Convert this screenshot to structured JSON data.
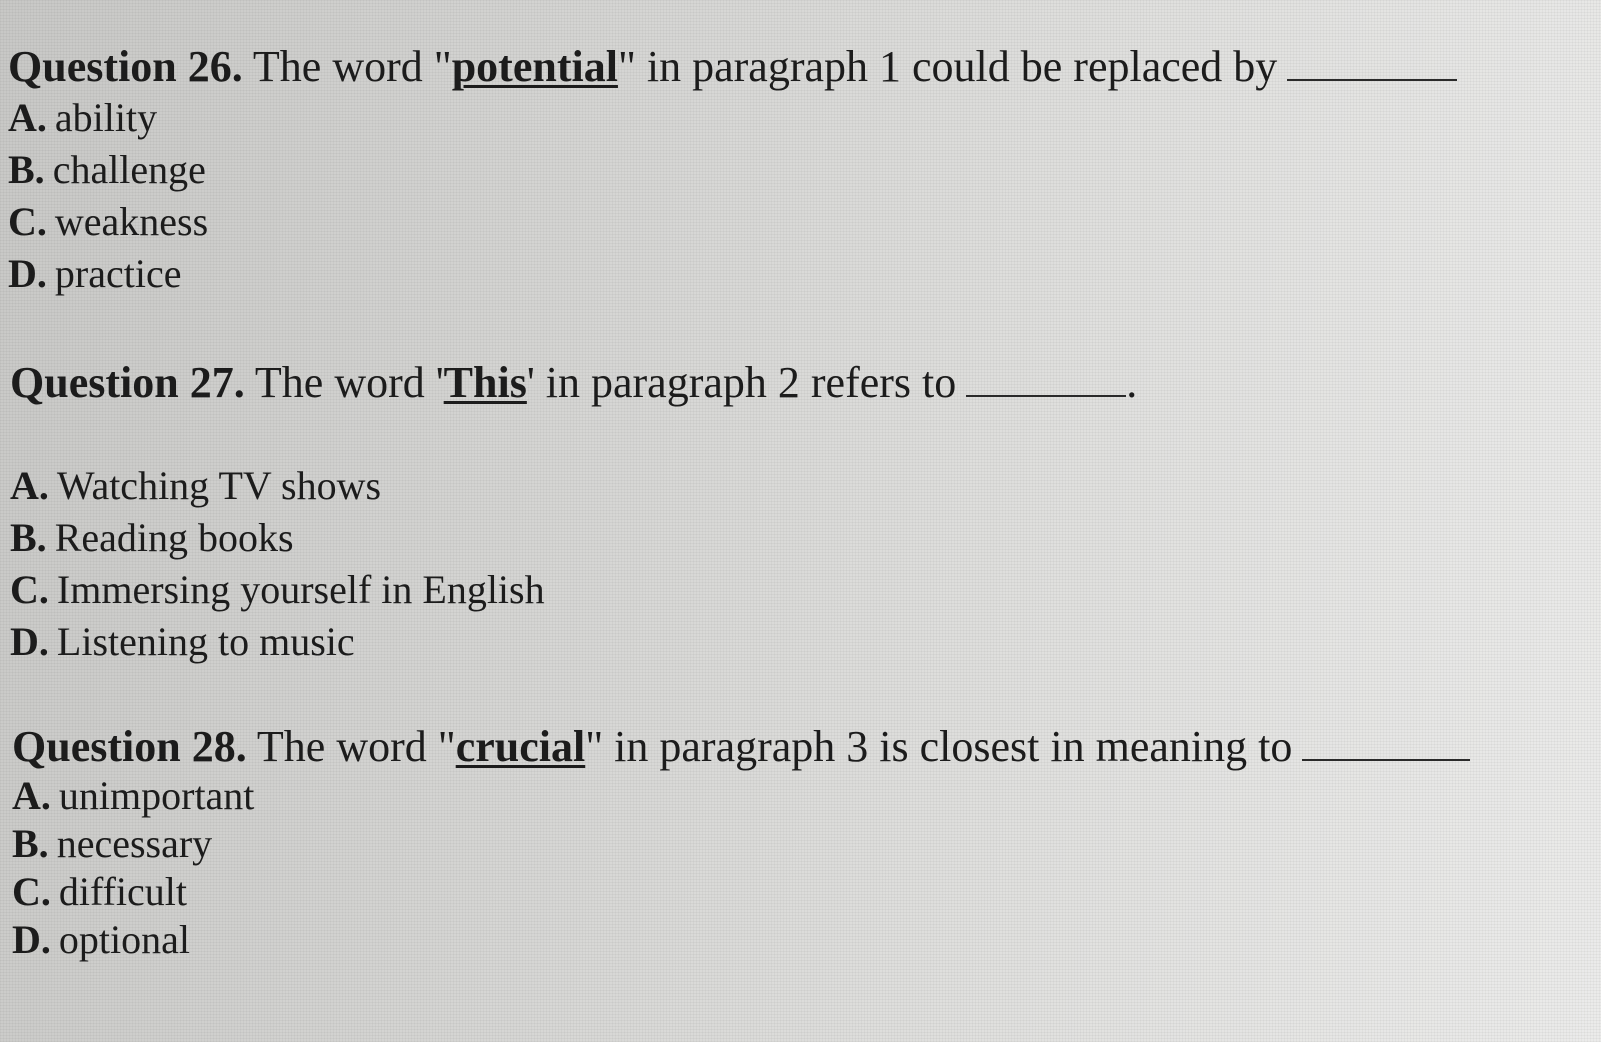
{
  "questions": [
    {
      "number": "Question 26.",
      "stem_before": " The word \"",
      "keyword": "potential",
      "stem_after": "\" in paragraph 1 could be replaced by",
      "options": [
        {
          "letter": "A.",
          "text": "ability"
        },
        {
          "letter": "B.",
          "text": "challenge"
        },
        {
          "letter": "C.",
          "text": "weakness"
        },
        {
          "letter": "D.",
          "text": "practice"
        }
      ]
    },
    {
      "number": "Question 27.",
      "stem_before": " The word '",
      "keyword": "This",
      "stem_after": "' in paragraph 2 refers to",
      "stem_end": ".",
      "options": [
        {
          "letter": "A.",
          "text": "Watching TV shows"
        },
        {
          "letter": "B.",
          "text": "Reading books"
        },
        {
          "letter": "C.",
          "text": "Immersing yourself in English"
        },
        {
          "letter": "D.",
          "text": "Listening to music"
        }
      ]
    },
    {
      "number": "Question 28.",
      "stem_before": " The word \"",
      "keyword": "crucial",
      "stem_after": "\" in paragraph 3 is closest in meaning to",
      "options": [
        {
          "letter": "A.",
          "text": "unimportant"
        },
        {
          "letter": "B.",
          "text": "necessary"
        },
        {
          "letter": "C.",
          "text": "difficult"
        },
        {
          "letter": "D.",
          "text": "optional"
        }
      ]
    }
  ]
}
